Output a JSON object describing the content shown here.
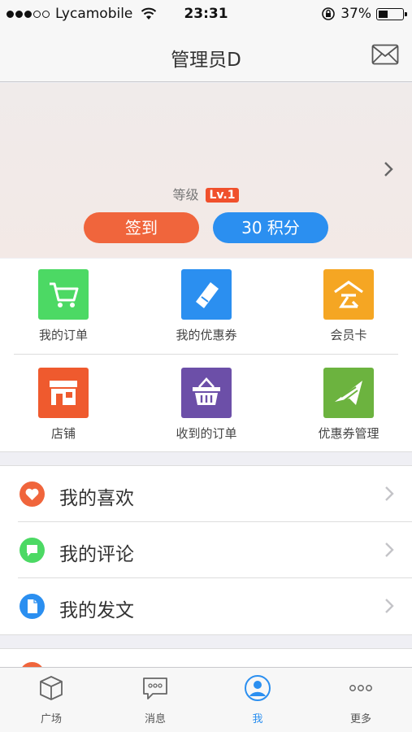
{
  "status_bar": {
    "carrier": "Lycamobile",
    "time": "23:31",
    "battery": "37%"
  },
  "nav": {
    "title": "管理员D"
  },
  "profile": {
    "level_label": "等级",
    "level_badge": "Lv.1",
    "checkin_label": "签到",
    "points_label": "30 积分"
  },
  "grid": [
    {
      "label": "我的订单",
      "icon": "cart-icon",
      "color": "#4cd964"
    },
    {
      "label": "我的优惠券",
      "icon": "ticket-icon",
      "color": "#2b8ff0"
    },
    {
      "label": "会员卡",
      "icon": "member-card-icon",
      "color": "#f5a623"
    },
    {
      "label": "店铺",
      "icon": "store-icon",
      "color": "#ef5a2e"
    },
    {
      "label": "收到的订单",
      "icon": "basket-icon",
      "color": "#6c4fa8"
    },
    {
      "label": "优惠券管理",
      "icon": "coupon-manage-icon",
      "color": "#6cb33f"
    }
  ],
  "list": [
    {
      "label": "我的喜欢",
      "icon": "heart-icon",
      "color": "#f0653c"
    },
    {
      "label": "我的评论",
      "icon": "comment-icon",
      "color": "#4cd964"
    },
    {
      "label": "我的发文",
      "icon": "document-icon",
      "color": "#2b8ff0"
    }
  ],
  "tabs": [
    {
      "label": "广场",
      "icon": "cube-icon"
    },
    {
      "label": "消息",
      "icon": "message-icon"
    },
    {
      "label": "我",
      "icon": "profile-icon",
      "active": true
    },
    {
      "label": "更多",
      "icon": "more-icon"
    }
  ],
  "colors": {
    "accent": "#2b8ff0",
    "checkin": "#f0653c",
    "level_badge": "#f0502c"
  }
}
